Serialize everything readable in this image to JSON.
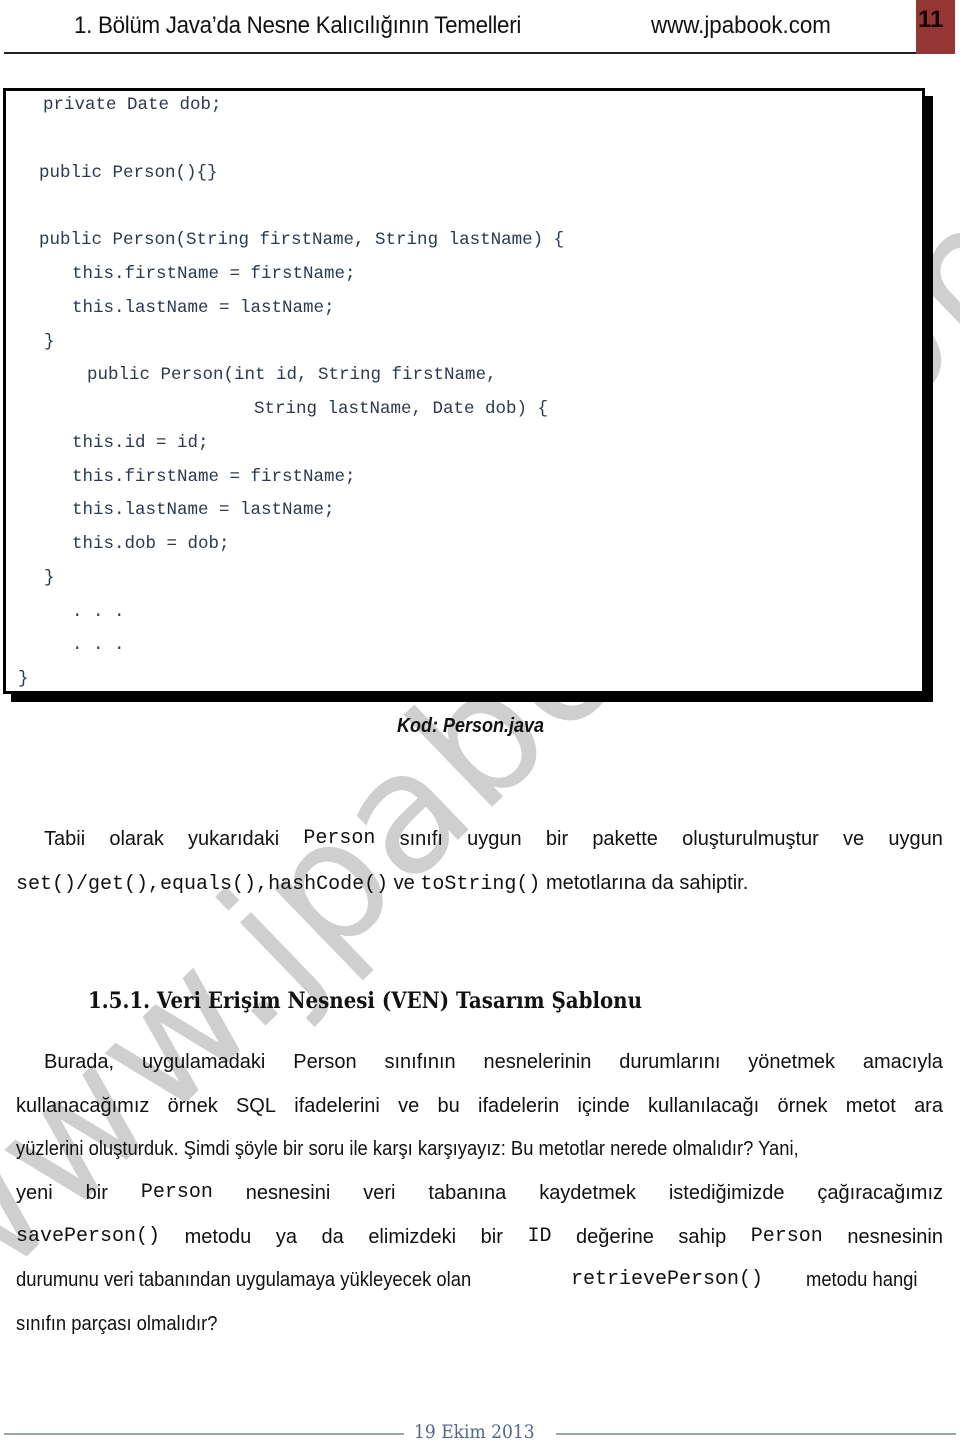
{
  "header": {
    "chapter_title": "1. Bölüm Java’da Nesne Kalıcılığının Temelleri",
    "site": "www.jpabook.com",
    "page_number": "11",
    "page_number_bg": "#943634"
  },
  "watermark": "www.jpabook.com",
  "code_block": {
    "lines": [
      "private Date dob;",
      "public Person(){}",
      "public Person(String firstName, String lastName) {",
      "this.firstName = firstName;",
      "this.lastName = lastName;",
      "}",
      "public Person(int id, String firstName,",
      "String lastName, Date dob) {",
      "this.id = id;",
      "this.firstName = firstName;",
      "this.lastName = lastName;",
      "this.dob = dob;",
      "}",
      ". . .",
      ". . .",
      "}"
    ],
    "caption": "Kod: Person.java"
  },
  "paragraph1": {
    "line1_words": [
      "Tabii",
      "olarak",
      "yukarıdaki",
      "Person",
      "sınıfı",
      "uygun",
      "bir",
      "pakette",
      "oluşturulmuştur",
      "ve",
      "uygun"
    ],
    "line2": {
      "code1": "set()/get(),",
      "code2": "equals(),",
      "code3": "hashCode()",
      "text1": "ve",
      "code4": "toString()",
      "text2": "metotlarına da sahiptir."
    }
  },
  "section": {
    "heading": "1.5.1. Veri Erişim Nesnesi (VEN) Tasarım Şablonu"
  },
  "paragraph2": {
    "line1_words": [
      "Burada,",
      "uygulamadaki",
      "Person",
      "sınıfının",
      "nesnelerinin",
      "durumlarını",
      "yönetmek",
      "amacıyla"
    ],
    "line2_words": [
      "kullanacağımız",
      "örnek",
      "SQL",
      "ifadelerini",
      "ve",
      "bu",
      "ifadelerin",
      "içinde",
      "kullanılacağı",
      "örnek",
      "metot",
      "ara"
    ],
    "line3": "yüzlerini oluşturduk. Şimdi şöyle bir soru ile karşı karşıyayız: Bu metotlar nerede olmalıdır? Yani,",
    "line4_words": [
      "yeni",
      "bir",
      "Person",
      "nesnesini",
      "veri",
      "tabanına",
      "kaydetmek",
      "istediğimizde",
      "çağıracağımız"
    ],
    "line5_words": [
      "savePerson()",
      "metodu",
      "ya",
      "da",
      "elimizdeki",
      "bir",
      "ID",
      "değerine",
      "sahip",
      "Person",
      "nesnesinin"
    ],
    "line6": {
      "text1": "durumunu veri tabanından uygulamaya yükleyecek olan",
      "code": "retrievePerson()",
      "text2": "metodu hangi"
    },
    "line7": "sınıfın parçası olmalıdır?"
  },
  "footer": {
    "date": "19 Ekim 2013"
  }
}
